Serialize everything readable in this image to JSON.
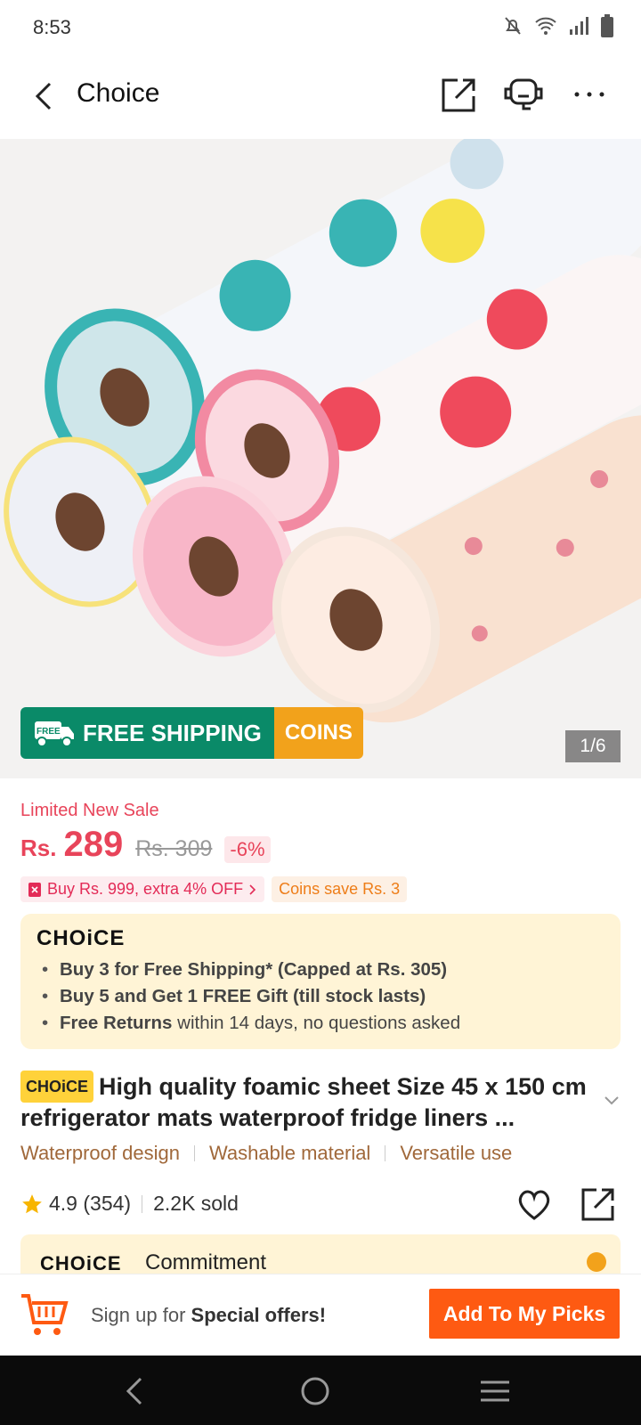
{
  "status_bar": {
    "time": "8:53"
  },
  "header": {
    "title": "Choice"
  },
  "gallery": {
    "badge_free_shipping": "FREE SHIPPING",
    "badge_free_icon_text": "FREE",
    "badge_coins": "COINS",
    "pager": "1/6"
  },
  "pricing": {
    "sale_label": "Limited New Sale",
    "currency": "Rs.",
    "price": "289",
    "original_price": "Rs. 309",
    "discount": "-6%",
    "promo_extra": "Buy Rs. 999, extra 4% OFF",
    "promo_coins": "Coins save Rs. 3"
  },
  "choice_box": {
    "logo": "CHOiCE",
    "benefits": [
      {
        "bold": "Buy 3 for  Free Shipping* (Capped at Rs. 305)",
        "rest": ""
      },
      {
        "bold": "Buy 5 and Get 1 FREE Gift (till stock lasts)",
        "rest": ""
      },
      {
        "bold": "Free Returns",
        "rest": " within 14 days, no questions asked"
      }
    ]
  },
  "product": {
    "tag": "CHOiCE",
    "title": "High quality foamic sheet Size 45 x 150 cm refrigerator mats waterproof fridge liners ...",
    "features": [
      "Waterproof design",
      "Washable material",
      "Versatile use"
    ],
    "rating": "4.9 (354)",
    "sold": "2.2K sold"
  },
  "commitment": {
    "logo": "CHOiCE",
    "label": "Commitment"
  },
  "bottom_bar": {
    "signup_prefix": "Sign up for ",
    "signup_bold": "Special offers!",
    "picks_button": "Add To My Picks"
  },
  "colors": {
    "accent_orange": "#fe5a12",
    "sale_red": "#e8445a",
    "shipping_green": "#0a8a68",
    "coins_orange": "#f2a21b",
    "choice_bg": "#fff4d6"
  }
}
